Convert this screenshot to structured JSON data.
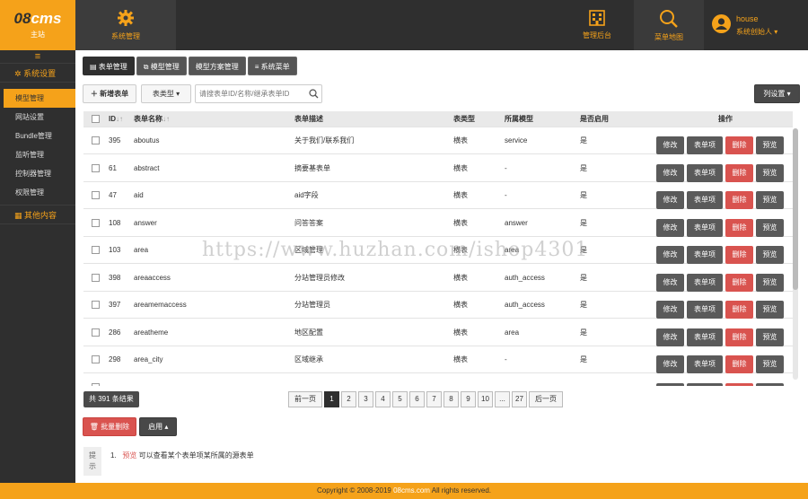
{
  "brand": {
    "logo_a": "08",
    "logo_b": "cms",
    "sub": "主站"
  },
  "header": {
    "system_label": "系统管理",
    "backend_label": "管理后台",
    "sitemap_label": "菜单地图",
    "user_name": "house",
    "user_role": "系统创始人"
  },
  "sidebar": {
    "menu_glyph": "≡",
    "group1": "系统设置",
    "items": [
      "模型管理",
      "网站设置",
      "Bundle管理",
      "监听管理",
      "控制器管理",
      "权限管理"
    ],
    "group2": "其他内容"
  },
  "tabs": [
    "表单管理",
    "模型管理",
    "模型方案管理",
    "系统菜单"
  ],
  "toolbar": {
    "add_label": "新增表单",
    "type_select": "表类型",
    "search_placeholder": "请搜表单ID/名称/继承表单ID",
    "columns_label": "列设置"
  },
  "table": {
    "headers": {
      "id": "ID",
      "name": "表单名称",
      "desc": "表单描述",
      "type": "表类型",
      "model": "所属模型",
      "enabled": "是否启用",
      "ops": "操作"
    },
    "sort_glyph": "↓↑",
    "rows": [
      {
        "id": "395",
        "name": "aboutus",
        "desc": "关于我们/联系我们",
        "type": "横表",
        "model": "service",
        "enabled": "是"
      },
      {
        "id": "61",
        "name": "abstract",
        "desc": "摘要基表单",
        "type": "横表",
        "model": "-",
        "enabled": "是"
      },
      {
        "id": "47",
        "name": "aid",
        "desc": "aid字段",
        "type": "横表",
        "model": "-",
        "enabled": "是"
      },
      {
        "id": "108",
        "name": "answer",
        "desc": "问答答案",
        "type": "横表",
        "model": "answer",
        "enabled": "是"
      },
      {
        "id": "103",
        "name": "area",
        "desc": "区域管理",
        "type": "横表",
        "model": "area",
        "enabled": "是"
      },
      {
        "id": "398",
        "name": "areaaccess",
        "desc": "分站管理员修改",
        "type": "横表",
        "model": "auth_access",
        "enabled": "是"
      },
      {
        "id": "397",
        "name": "areamemaccess",
        "desc": "分站管理员",
        "type": "横表",
        "model": "auth_access",
        "enabled": "是"
      },
      {
        "id": "286",
        "name": "areatheme",
        "desc": "地区配置",
        "type": "横表",
        "model": "area",
        "enabled": "是"
      },
      {
        "id": "298",
        "name": "area_city",
        "desc": "区域继承",
        "type": "横表",
        "model": "-",
        "enabled": "是"
      }
    ],
    "actions": {
      "edit": "修改",
      "fields": "表单项",
      "delete": "删除",
      "preview": "预览"
    }
  },
  "pagination": {
    "total": "共 391 条结果",
    "prev": "前一页",
    "pages": [
      "1",
      "2",
      "3",
      "4",
      "5",
      "6",
      "7",
      "8",
      "9",
      "10",
      "...",
      "27"
    ],
    "current": "1",
    "next": "后一页"
  },
  "bulk": {
    "delete_label": "批量删除",
    "enable_label": "启用"
  },
  "hint": {
    "label_a": "提",
    "label_b": "示",
    "num": "1.",
    "em": "预览",
    "text": "可以查看某个表单项某所属的源表单"
  },
  "footer": {
    "copyright": "Copyright © 2008-2019 ",
    "site": "08cms.com",
    "rest": " All rights reserved."
  },
  "watermark": "https://www.huzhan.com/ishop4301",
  "colors": {
    "accent": "#f5a21a",
    "dark": "#2f2f2f",
    "danger": "#d9534f"
  }
}
